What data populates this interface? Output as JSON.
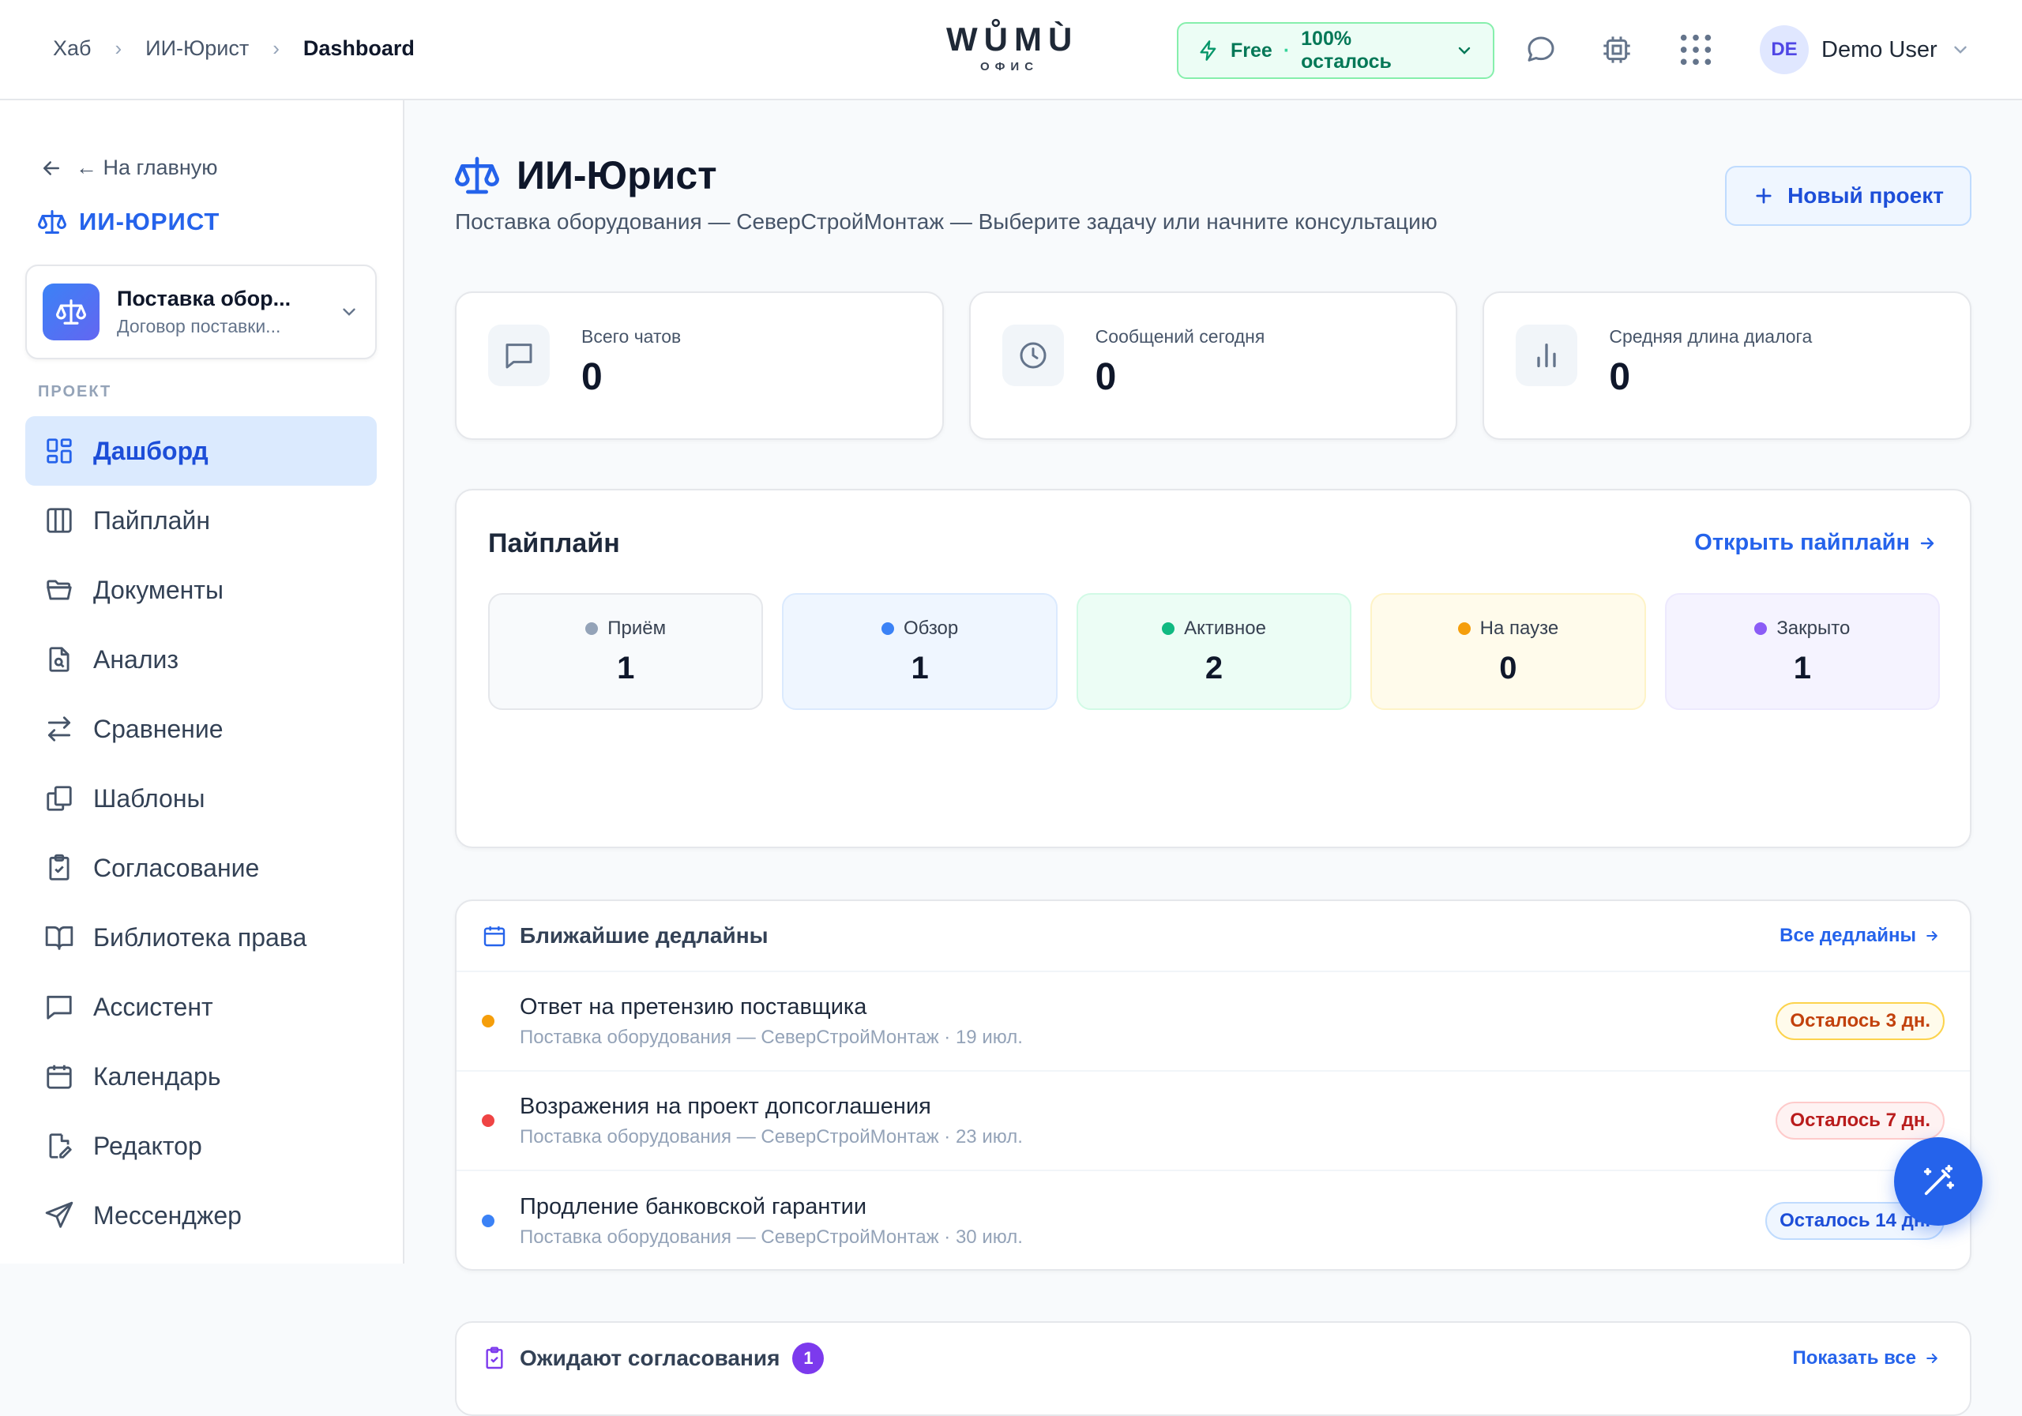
{
  "breadcrumb": {
    "items": [
      "Хаб",
      "ИИ-Юрист"
    ],
    "current": "Dashboard"
  },
  "logo": {
    "brand": "WŮMÙ",
    "sub": "ОФИС"
  },
  "plan": {
    "tier": "Free",
    "separator": "·",
    "remaining": "100% осталось"
  },
  "user": {
    "initials": "DE",
    "name": "Demo User"
  },
  "sidebar": {
    "back_label": "← На главную",
    "section_title": "ИИ-ЮРИСТ",
    "project": {
      "name": "Поставка обор...",
      "subtitle": "Договор поставки..."
    },
    "group_label": "ПРОЕКТ",
    "items": [
      {
        "label": "Дашборд",
        "icon": "dashboard-icon"
      },
      {
        "label": "Пайплайн",
        "icon": "columns-icon"
      },
      {
        "label": "Документы",
        "icon": "folder-icon"
      },
      {
        "label": "Анализ",
        "icon": "file-search-icon"
      },
      {
        "label": "Сравнение",
        "icon": "arrows-swap-icon"
      },
      {
        "label": "Шаблоны",
        "icon": "copy-icon"
      },
      {
        "label": "Согласование",
        "icon": "clipboard-check-icon"
      },
      {
        "label": "Библиотека права",
        "icon": "book-icon"
      },
      {
        "label": "Ассистент",
        "icon": "chat-icon"
      },
      {
        "label": "Календарь",
        "icon": "calendar-icon"
      },
      {
        "label": "Редактор",
        "icon": "file-edit-icon"
      },
      {
        "label": "Мессенджер",
        "icon": "send-icon"
      }
    ]
  },
  "main": {
    "title": "ИИ-Юрист",
    "subtitle": "Поставка оборудования — СеверСтройМонтаж — Выберите задачу или начните консультацию",
    "new_project_label": "Новый проект",
    "stats": [
      {
        "label": "Всего чатов",
        "value": "0",
        "icon": "chat-icon"
      },
      {
        "label": "Сообщений сегодня",
        "value": "0",
        "icon": "clock-icon"
      },
      {
        "label": "Средняя длина диалога",
        "value": "0",
        "icon": "bar-chart-icon"
      }
    ],
    "pipeline": {
      "title": "Пайплайн",
      "link": "Открыть пайплайн",
      "stages": [
        {
          "label": "Приём",
          "count": "1",
          "dot": "#94a3b8",
          "bg": "#f8fafc",
          "border": "#e5e7eb"
        },
        {
          "label": "Обзор",
          "count": "1",
          "dot": "#3b82f6",
          "bg": "#eff6ff",
          "border": "#dbeafe"
        },
        {
          "label": "Активное",
          "count": "2",
          "dot": "#10b981",
          "bg": "#ecfdf5",
          "border": "#d1fae5"
        },
        {
          "label": "На паузе",
          "count": "0",
          "dot": "#f59e0b",
          "bg": "#fffbeb",
          "border": "#fef3c7"
        },
        {
          "label": "Закрыто",
          "count": "1",
          "dot": "#8b5cf6",
          "bg": "#f5f3ff",
          "border": "#ede9fe"
        }
      ]
    },
    "deadlines": {
      "title": "Ближайшие дедлайны",
      "link": "Все дедлайны",
      "items": [
        {
          "name": "Ответ на претензию поставщика",
          "meta": "Поставка оборудования — СеверСтройМонтаж · 19 июл.",
          "badge": "Осталось 3 дн.",
          "dot": "#f59e0b",
          "badge_color": "#c2410c",
          "badge_bg": "#fffbeb",
          "badge_border": "#fcd34d"
        },
        {
          "name": "Возражения на проект допсоглашения",
          "meta": "Поставка оборудования — СеверСтройМонтаж · 23 июл.",
          "badge": "Осталось 7 дн.",
          "dot": "#ef4444",
          "badge_color": "#b91c1c",
          "badge_bg": "#fef2f2",
          "badge_border": "#fecaca"
        },
        {
          "name": "Продление банковской гарантии",
          "meta": "Поставка оборудования — СеверСтройМонтаж · 30 июл.",
          "badge": "Осталось 14 дн.",
          "dot": "#3b82f6",
          "badge_color": "#1d4ed8",
          "badge_bg": "#eff6ff",
          "badge_border": "#bfdbfe"
        }
      ]
    },
    "approvals": {
      "title": "Ожидают согласования",
      "count": "1",
      "link": "Показать все"
    }
  }
}
